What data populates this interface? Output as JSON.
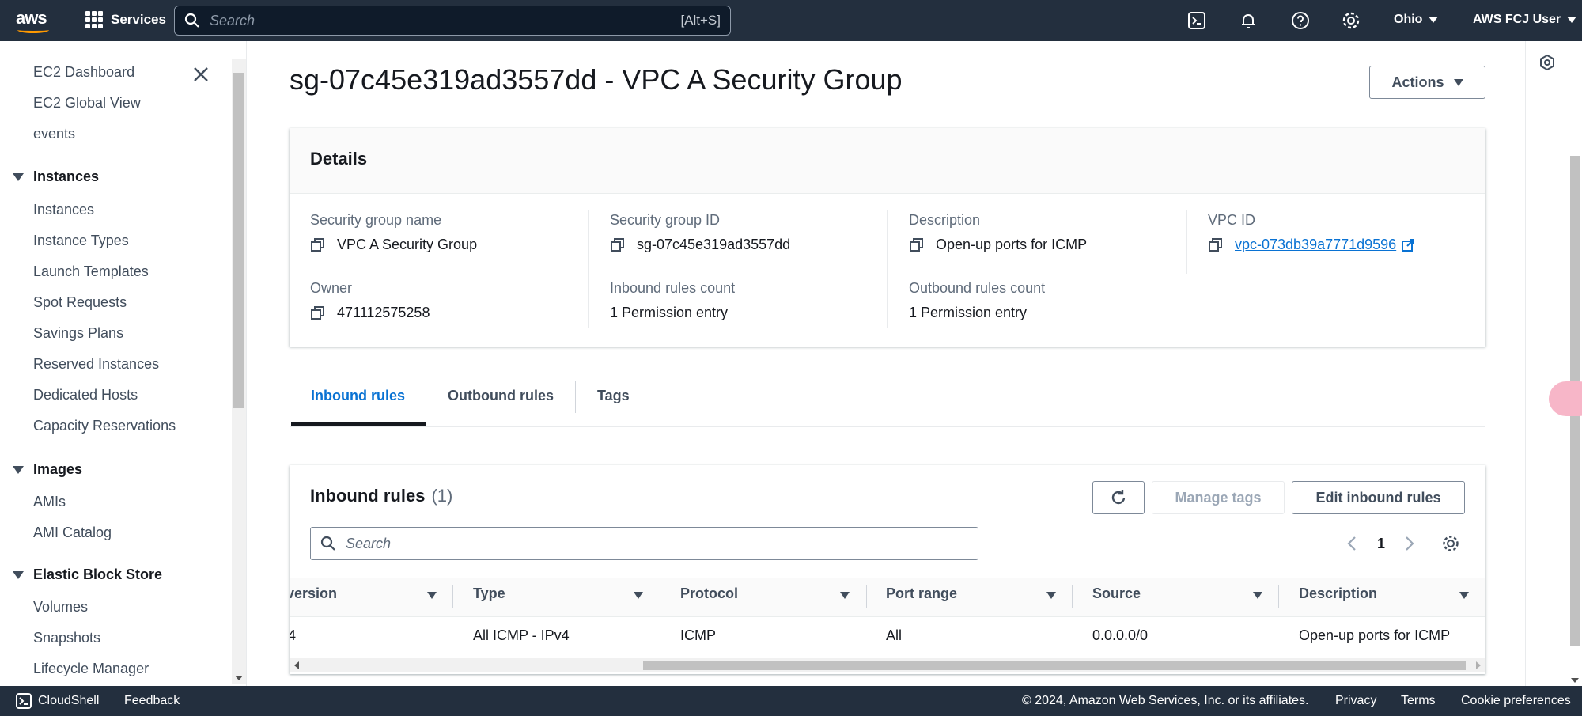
{
  "topnav": {
    "logo_text": "aws",
    "services_label": "Services",
    "search_placeholder": "Search",
    "search_shortcut": "[Alt+S]",
    "region": "Ohio",
    "user": "AWS FCJ User"
  },
  "sidebar": {
    "top_items": [
      "EC2 Dashboard",
      "EC2 Global View",
      "events"
    ],
    "sections": [
      {
        "title": "Instances",
        "items": [
          "Instances",
          "Instance Types",
          "Launch Templates",
          "Spot Requests",
          "Savings Plans",
          "Reserved Instances",
          "Dedicated Hosts",
          "Capacity Reservations"
        ]
      },
      {
        "title": "Images",
        "items": [
          "AMIs",
          "AMI Catalog"
        ]
      },
      {
        "title": "Elastic Block Store",
        "items": [
          "Volumes",
          "Snapshots",
          "Lifecycle Manager"
        ]
      }
    ]
  },
  "page": {
    "title": "sg-07c45e319ad3557dd - VPC A Security Group",
    "actions_label": "Actions"
  },
  "details": {
    "title": "Details",
    "fields": [
      {
        "label": "Security group name",
        "value": "VPC A Security Group"
      },
      {
        "label": "Security group ID",
        "value": "sg-07c45e319ad3557dd"
      },
      {
        "label": "Description",
        "value": "Open-up ports for ICMP"
      },
      {
        "label": "VPC ID",
        "value": "vpc-073db39a7771d9596"
      },
      {
        "label": "Owner",
        "value": "471112575258"
      },
      {
        "label": "Inbound rules count",
        "value": "1 Permission entry"
      },
      {
        "label": "Outbound rules count",
        "value": "1 Permission entry"
      }
    ]
  },
  "tabs": [
    "Inbound rules",
    "Outbound rules",
    "Tags"
  ],
  "inbound": {
    "title": "Inbound rules",
    "count": "(1)",
    "manage_tags": "Manage tags",
    "edit_rules": "Edit inbound rules",
    "search_placeholder": "Search",
    "page_number": "1",
    "columns": [
      "version",
      "Type",
      "Protocol",
      "Port range",
      "Source",
      "Description"
    ],
    "rows": [
      [
        "4",
        "All ICMP - IPv4",
        "ICMP",
        "All",
        "0.0.0.0/0",
        "Open-up ports for ICMP"
      ]
    ]
  },
  "footer": {
    "cloudshell": "CloudShell",
    "feedback": "Feedback",
    "copyright": "© 2024, Amazon Web Services, Inc. or its affiliates.",
    "privacy": "Privacy",
    "terms": "Terms",
    "cookies": "Cookie preferences"
  },
  "colors": {
    "nav_bg": "#232f3e",
    "link": "#0972d3",
    "accent": "#ff9900"
  }
}
